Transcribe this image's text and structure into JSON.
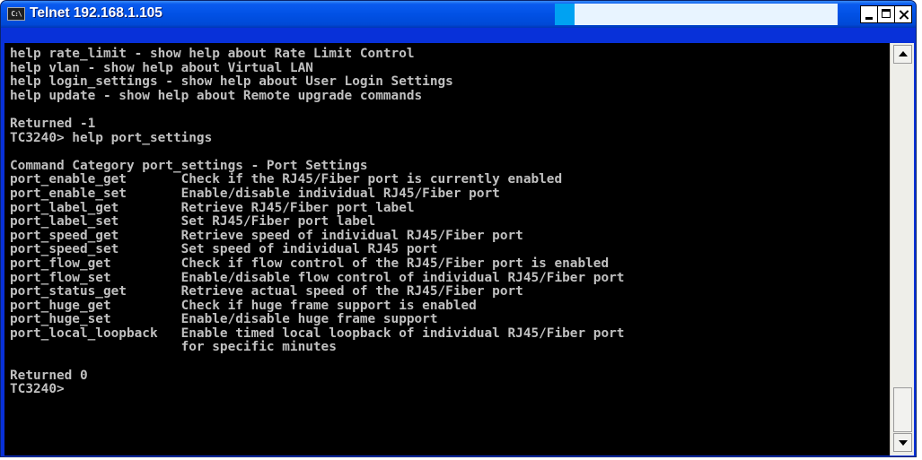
{
  "window": {
    "title": "Telnet 192.168.1.105",
    "icon_name": "console-icon",
    "icon_glyph": "C:\\"
  },
  "controls": {
    "minimize_icon": "minimize-icon",
    "maximize_icon": "maximize-icon",
    "close_icon": "close-icon"
  },
  "console": {
    "lines": [
      "help rate_limit - show help about Rate Limit Control",
      "help vlan - show help about Virtual LAN",
      "help login_settings - show help about User Login Settings",
      "help update - show help about Remote upgrade commands",
      "",
      "Returned -1",
      "TC3240> help port_settings",
      "",
      "Command Category port_settings - Port Settings",
      "port_enable_get       Check if the RJ45/Fiber port is currently enabled",
      "port_enable_set       Enable/disable individual RJ45/Fiber port",
      "port_label_get        Retrieve RJ45/Fiber port label",
      "port_label_set        Set RJ45/Fiber port label",
      "port_speed_get        Retrieve speed of individual RJ45/Fiber port",
      "port_speed_set        Set speed of individual RJ45 port",
      "port_flow_get         Check if flow control of the RJ45/Fiber port is enabled",
      "port_flow_set         Enable/disable flow control of individual RJ45/Fiber port",
      "port_status_get       Retrieve actual speed of the RJ45/Fiber port",
      "port_huge_get         Check if huge frame support is enabled",
      "port_huge_set         Enable/disable huge frame support",
      "port_local_loopback   Enable timed local loopback of individual RJ45/Fiber port",
      "                      for specific minutes",
      "",
      "Returned 0",
      "TC3240>"
    ]
  },
  "scrollbar": {
    "up_icon": "scroll-up-arrow-icon",
    "down_icon": "scroll-down-arrow-icon",
    "scroll_position": 1.0
  },
  "colors": {
    "titlebar": "#0151e5",
    "console_background": "#000000",
    "console_text": "#c0c0c0"
  }
}
